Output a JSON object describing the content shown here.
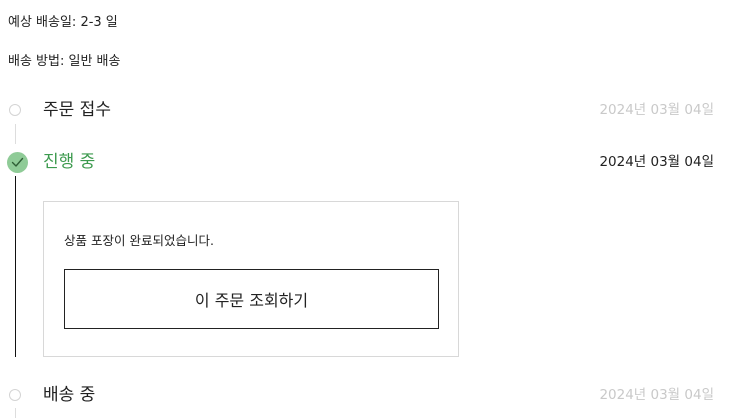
{
  "shipping": {
    "estimated_label": "예상 배송일: 2-3 일",
    "method_label": "배송 방법: 일반 배송"
  },
  "timeline": [
    {
      "title": "주문 접수",
      "date": "2024년 03월 04일",
      "status": "pending"
    },
    {
      "title": "진행 중",
      "date": "2024년 03월 04일",
      "status": "active"
    },
    {
      "title": "배송 중",
      "date": "2024년 03월 04일",
      "status": "pending"
    }
  ],
  "detail": {
    "message": "상품 포장이 완료되었습니다.",
    "button_label": "이 주문 조회하기"
  },
  "colors": {
    "active_text": "#3c9a4e",
    "check_fill": "#8fcb97",
    "inactive_date": "#c9c9c9",
    "border": "#d8d8d8",
    "active_line": "#111111"
  },
  "icons": {
    "pending_marker": "empty-circle-icon",
    "active_marker": "check-circle-icon"
  }
}
